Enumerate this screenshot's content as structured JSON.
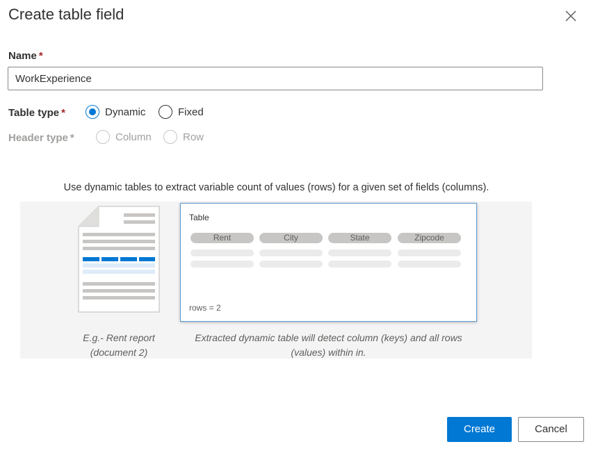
{
  "dialog": {
    "title": "Create table field"
  },
  "name_field": {
    "label": "Name",
    "required_mark": "*",
    "value": "WorkExperience"
  },
  "table_type": {
    "label": "Table type",
    "required_mark": "*",
    "options": [
      {
        "label": "Dynamic",
        "selected": true
      },
      {
        "label": "Fixed",
        "selected": false
      }
    ]
  },
  "header_type": {
    "label": "Header type",
    "required_mark": "*",
    "disabled": true,
    "options": [
      {
        "label": "Column",
        "selected": false
      },
      {
        "label": "Row",
        "selected": false
      }
    ]
  },
  "help_text": "Use dynamic tables to extract variable count of values (rows) for a given set of fields (columns).",
  "illustration": {
    "table_title": "Table",
    "columns": [
      "Rent",
      "City",
      "State",
      "Zipcode"
    ],
    "rows_label": "rows = 2",
    "doc_caption_line1": "E.g.- Rent report",
    "doc_caption_line2": "(document 2)",
    "table_caption_line1": "Extracted dynamic table will detect column (keys) and all rows",
    "table_caption_line2": "(values) within in."
  },
  "footer": {
    "create_label": "Create",
    "cancel_label": "Cancel"
  },
  "colors": {
    "accent": "#0078d4",
    "required": "#a4262c",
    "text": "#323130",
    "disabled": "#a19f9d"
  }
}
